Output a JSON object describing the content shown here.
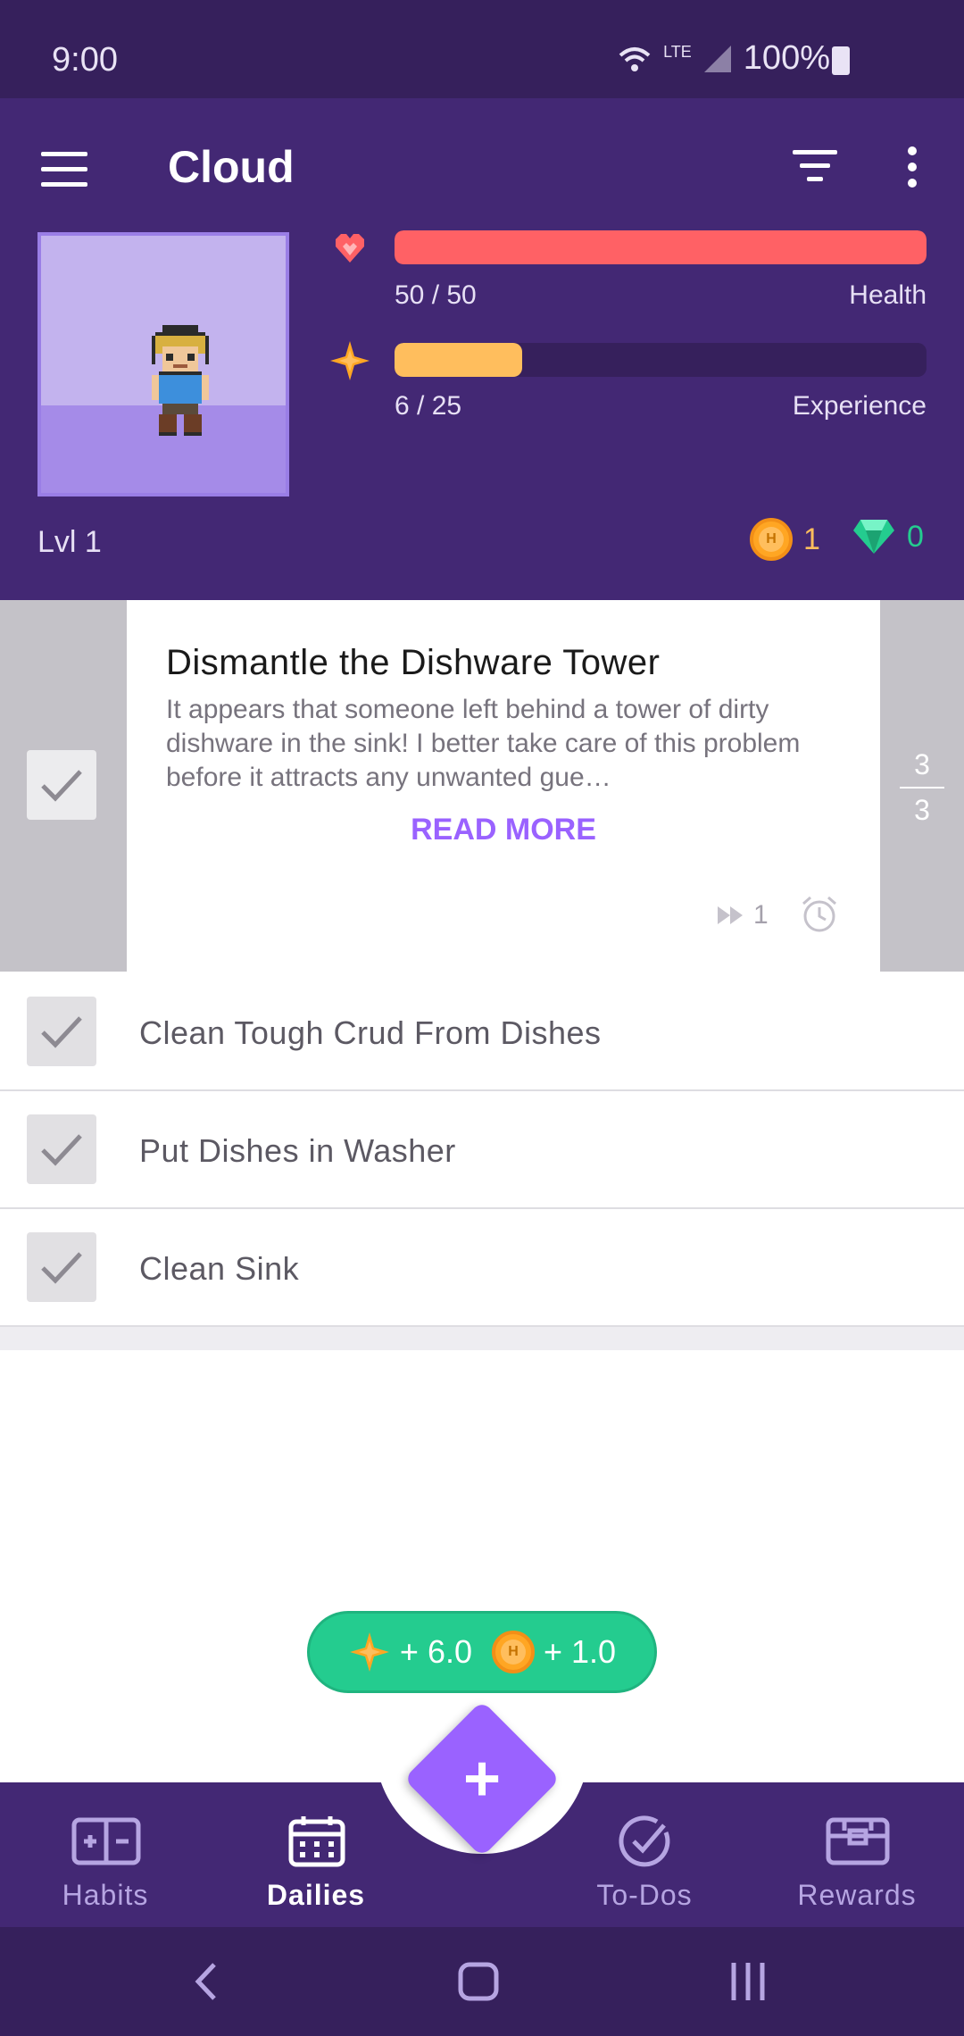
{
  "status_bar": {
    "time": "9:00",
    "network": "LTE",
    "battery": "100%"
  },
  "header": {
    "title": "Cloud",
    "health": {
      "value_text": "50 / 50",
      "label": "Health",
      "fraction": 1.0,
      "color": "#ff6165"
    },
    "experience": {
      "value_text": "6 / 25",
      "label": "Experience",
      "fraction": 0.24,
      "color": "#ffbe5d"
    },
    "level": "Lvl 1",
    "gold": "1",
    "gems": "0"
  },
  "featured_task": {
    "title": "Dismantle the Dishware Tower",
    "notes": "It appears that someone left behind a tower of dirty dishware in the sink! I better take care of this problem before it attracts any unwanted gue…",
    "read_more": "READ MORE",
    "streak": "1",
    "checklist_done": "3",
    "checklist_total": "3"
  },
  "checklist": [
    {
      "label": "Clean Tough Crud From Dishes"
    },
    {
      "label": "Put Dishes in Washer"
    },
    {
      "label": "Clean Sink"
    }
  ],
  "reward": {
    "exp": "+ 6.0",
    "gold": "+ 1.0"
  },
  "nav": {
    "habits": "Habits",
    "dailies": "Dailies",
    "todos": "To-Dos",
    "rewards": "Rewards",
    "active": "dailies"
  },
  "colors": {
    "brand": "#432874",
    "accent": "#9a62ff",
    "reward_green": "#24cc8f"
  }
}
